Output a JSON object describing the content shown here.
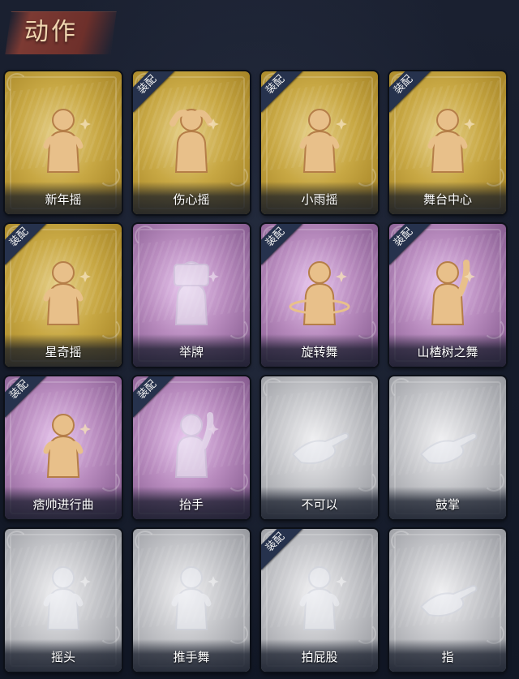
{
  "header": {
    "title": "动作"
  },
  "equip_label": "装配",
  "colors": {
    "gold_rarity": "#c8a844",
    "purple_rarity": "#b88bbe",
    "gray_rarity": "#c3c4c8",
    "figure_gold": "#e8c08a",
    "tag_bg": "#26324d"
  },
  "actions": [
    {
      "label": "新年摇",
      "rarity": "gold",
      "equipped": false,
      "icon": "dancer-clap-icon",
      "owned": true
    },
    {
      "label": "伤心摇",
      "rarity": "gold",
      "equipped": true,
      "icon": "heart-hands-icon",
      "owned": true
    },
    {
      "label": "小雨摇",
      "rarity": "gold",
      "equipped": true,
      "icon": "rain-dance-icon",
      "owned": true
    },
    {
      "label": "舞台中心",
      "rarity": "gold",
      "equipped": true,
      "icon": "stage-pose-icon",
      "owned": true
    },
    {
      "label": "星奇摇",
      "rarity": "gold",
      "equipped": true,
      "icon": "star-pose-icon",
      "owned": true
    },
    {
      "label": "举牌",
      "rarity": "purple",
      "equipped": false,
      "icon": "hold-sign-icon",
      "owned": false
    },
    {
      "label": "旋转舞",
      "rarity": "purple",
      "equipped": true,
      "icon": "spin-dance-icon",
      "owned": true
    },
    {
      "label": "山楂树之舞",
      "rarity": "purple",
      "equipped": true,
      "icon": "raise-arm-icon",
      "owned": true
    },
    {
      "label": "痞帅进行曲",
      "rarity": "purple",
      "equipped": true,
      "icon": "march-icon",
      "owned": true
    },
    {
      "label": "抬手",
      "rarity": "purple",
      "equipped": true,
      "icon": "raise-hand-icon",
      "owned": false
    },
    {
      "label": "不可以",
      "rarity": "gray",
      "equipped": false,
      "icon": "finger-wag-icon",
      "owned": false
    },
    {
      "label": "鼓掌",
      "rarity": "gray",
      "equipped": false,
      "icon": "clap-hands-icon",
      "owned": false
    },
    {
      "label": "摇头",
      "rarity": "gray",
      "equipped": false,
      "icon": "shake-head-icon",
      "owned": false
    },
    {
      "label": "推手舞",
      "rarity": "gray",
      "equipped": false,
      "icon": "push-hands-icon",
      "owned": false
    },
    {
      "label": "拍屁股",
      "rarity": "gray",
      "equipped": true,
      "icon": "pat-icon",
      "owned": false
    },
    {
      "label": "指",
      "rarity": "gray",
      "equipped": false,
      "icon": "point-finger-icon",
      "owned": false
    }
  ]
}
